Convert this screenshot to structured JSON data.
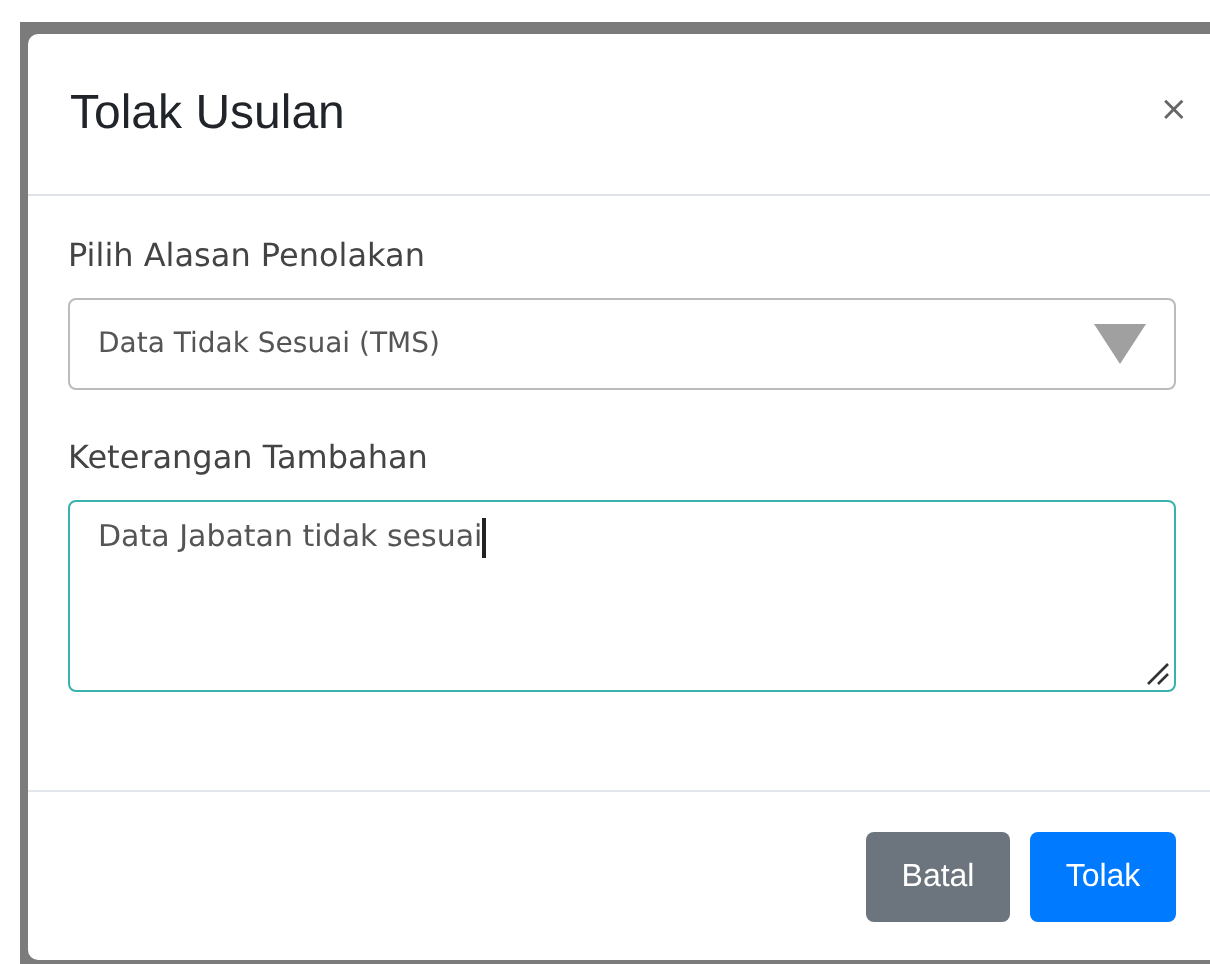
{
  "modal": {
    "title": "Tolak Usulan",
    "close": "×"
  },
  "fields": [
    {
      "kind": "select",
      "label": "Pilih Alasan Penolakan",
      "value": "Data Tidak Sesuai (TMS)",
      "focused": false
    },
    {
      "kind": "textarea",
      "label": "Keterangan Tambahan",
      "value": "Data Jabatan tidak sesuai",
      "focused": true
    }
  ],
  "buttons": [
    {
      "label": "Batal",
      "kind": "secondary"
    },
    {
      "label": "Tolak",
      "kind": "primary"
    }
  ]
}
